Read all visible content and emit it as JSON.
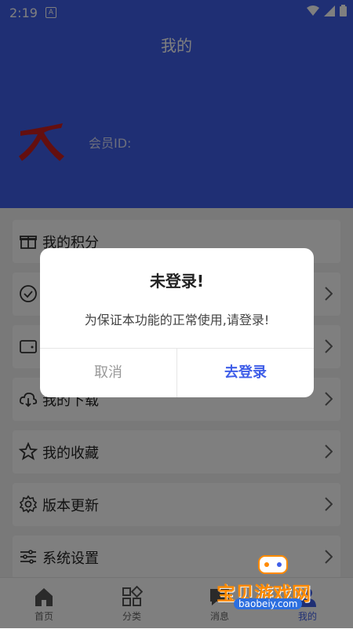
{
  "status_bar": {
    "time": "2:19",
    "notif_letter": "A"
  },
  "app_bar": {
    "title": "我的"
  },
  "profile": {
    "member_id_label": "会员ID:",
    "avatar_glyph": "大"
  },
  "menu": [
    {
      "label": "我的积分",
      "icon": "gift-icon"
    },
    {
      "label": "",
      "icon": "check-circle-icon"
    },
    {
      "label": "",
      "icon": "wallet-icon"
    },
    {
      "label": "我的下载",
      "icon": "cloud-download-icon"
    },
    {
      "label": "我的收藏",
      "icon": "star-icon"
    },
    {
      "label": "版本更新",
      "icon": "gear-icon"
    },
    {
      "label": "系统设置",
      "icon": "sliders-icon"
    }
  ],
  "tabs": [
    {
      "label": "首页",
      "icon": "home-icon"
    },
    {
      "label": "分类",
      "icon": "category-icon"
    },
    {
      "label": "消息",
      "icon": "message-icon"
    },
    {
      "label": "我的",
      "icon": "profile-icon",
      "active": true
    }
  ],
  "dialog": {
    "title": "未登录!",
    "message": "为保证本功能的正常使用,请登录!",
    "cancel_label": "取消",
    "confirm_label": "去登录"
  },
  "watermark": {
    "text": "宝贝游戏网",
    "url": "baobeiy.com"
  },
  "colors": {
    "primary": "#3f5ee8",
    "overlay": "rgba(0,0,0,0.5)",
    "avatar_red": "#c81e1e"
  }
}
